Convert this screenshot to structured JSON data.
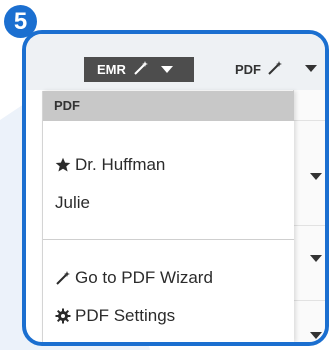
{
  "step": {
    "number": "5"
  },
  "toolbar": {
    "emr_label": "EMR",
    "pdf_label": "PDF"
  },
  "menu": {
    "header": "PDF",
    "items": [
      {
        "label": "Dr. Huffman",
        "icon": "star-icon"
      },
      {
        "label": "Julie",
        "icon": ""
      }
    ],
    "actions": [
      {
        "label": "Go to PDF Wizard",
        "icon": "magic-wand-icon"
      },
      {
        "label": "PDF Settings",
        "icon": "gear-icon"
      }
    ]
  },
  "colors": {
    "accent": "#1b6fd0",
    "emr_button_bg": "#4d4d4d",
    "menu_header_bg": "#c8c8c8"
  }
}
